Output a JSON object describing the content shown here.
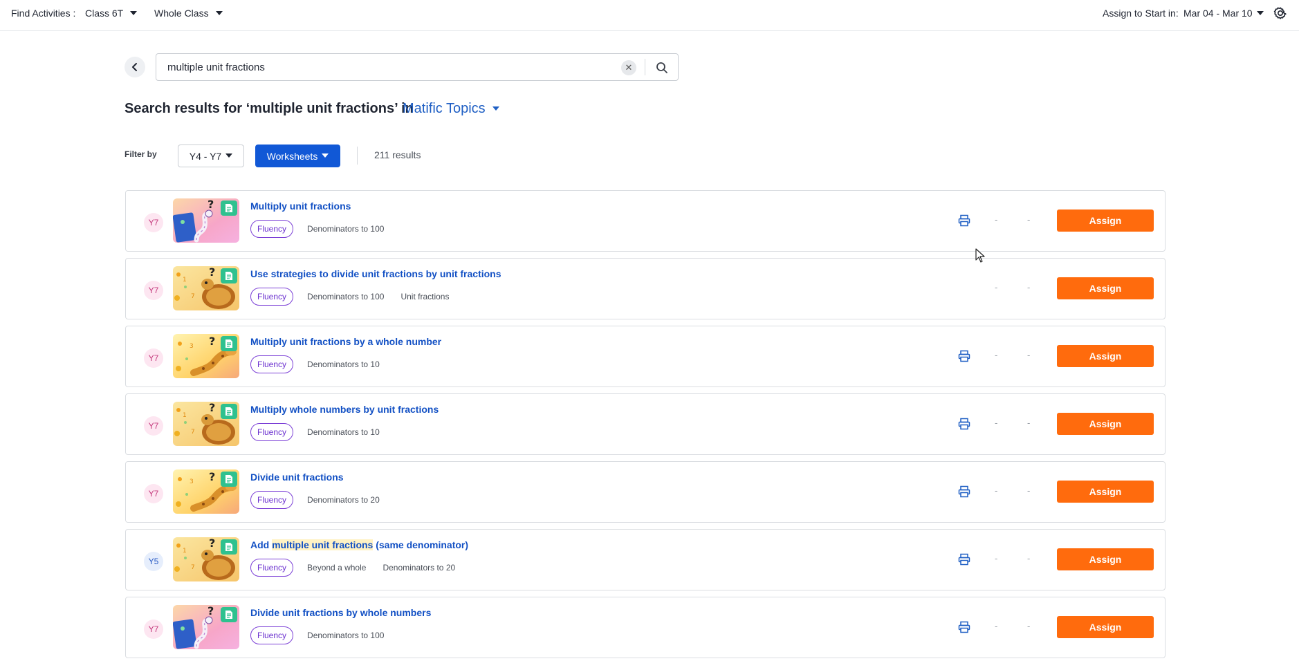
{
  "topbar": {
    "find_label": "Find Activities :",
    "class_value": "Class 6T",
    "group_value": "Whole Class",
    "assign_label": "Assign to Start in:",
    "date_range": "Mar 04 - Mar 10"
  },
  "search": {
    "value": "multiple unit fractions",
    "placeholder": ""
  },
  "heading": {
    "prefix": "Search results for ‘multiple unit fractions’ in",
    "scope": "Matific Topics"
  },
  "filters": {
    "label": "Filter by",
    "year_range": "Y4 - Y7",
    "type": "Worksheets",
    "results": "211 results"
  },
  "colors": {
    "accent_blue": "#1158d6",
    "assign_orange": "#ff6b0d",
    "fluency_purple": "#7b3fd6",
    "doc_green": "#2fc18f"
  },
  "rows": [
    {
      "year": "Y7",
      "thumb": "worm",
      "title": "Multiply unit fractions",
      "tag": "Fluency",
      "meta": [
        "Denominators to 100"
      ],
      "printable": true,
      "dash1": "-",
      "dash2": "-",
      "action": "Assign"
    },
    {
      "year": "Y7",
      "thumb": "turtle",
      "title": "Use strategies to divide unit fractions by unit fractions",
      "tag": "Fluency",
      "meta": [
        "Denominators to 100",
        "Unit fractions"
      ],
      "printable": false,
      "dash1": "-",
      "dash2": "-",
      "action": "Assign"
    },
    {
      "year": "Y7",
      "thumb": "giraffe",
      "title": "Multiply unit fractions by a whole number",
      "tag": "Fluency",
      "meta": [
        "Denominators to 10"
      ],
      "printable": true,
      "dash1": "-",
      "dash2": "-",
      "action": "Assign"
    },
    {
      "year": "Y7",
      "thumb": "turtle",
      "title": "Multiply whole numbers by unit fractions",
      "tag": "Fluency",
      "meta": [
        "Denominators to 10"
      ],
      "printable": true,
      "dash1": "-",
      "dash2": "-",
      "action": "Assign"
    },
    {
      "year": "Y7",
      "thumb": "giraffe",
      "title": "Divide unit fractions",
      "tag": "Fluency",
      "meta": [
        "Denominators to 20"
      ],
      "printable": true,
      "dash1": "-",
      "dash2": "-",
      "action": "Assign"
    },
    {
      "year": "Y5",
      "thumb": "turtle",
      "title_parts": [
        "Add ",
        "multiple unit fractions",
        " (same denominator)"
      ],
      "tag": "Fluency",
      "meta": [
        "Beyond a whole",
        "Denominators to 20"
      ],
      "printable": true,
      "dash1": "-",
      "dash2": "-",
      "action": "Assign"
    },
    {
      "year": "Y7",
      "thumb": "worm",
      "title": "Divide unit fractions by whole numbers",
      "tag": "Fluency",
      "meta": [
        "Denominators to 100"
      ],
      "printable": true,
      "dash1": "-",
      "dash2": "-",
      "action": "Assign"
    }
  ]
}
